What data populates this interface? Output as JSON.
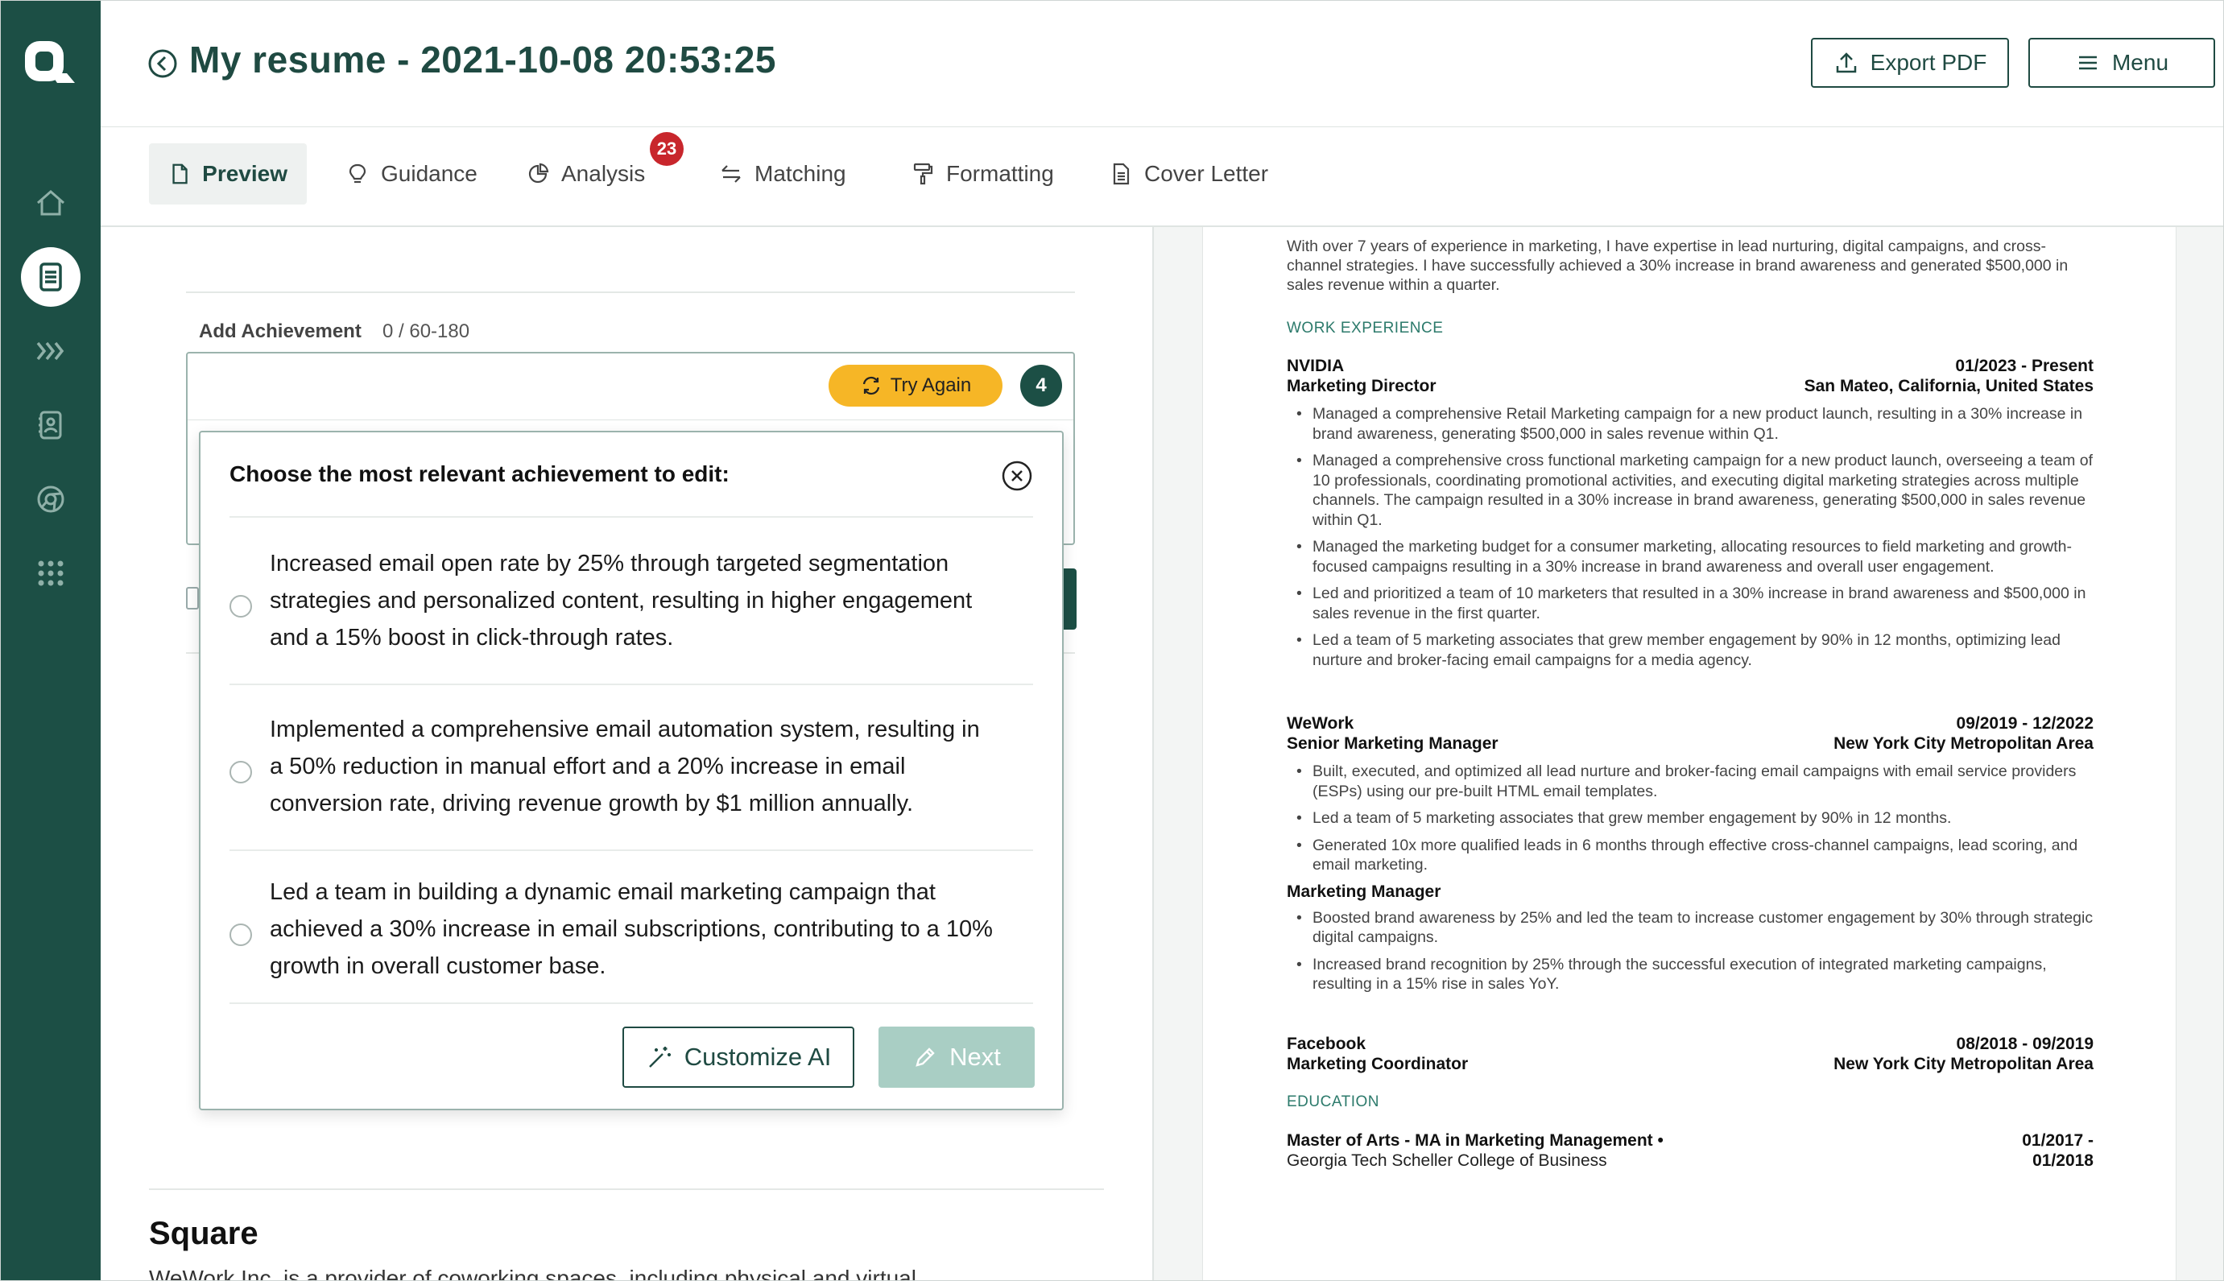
{
  "header": {
    "title": "My resume - 2021-10-08 20:53:25",
    "export_label": "Export PDF",
    "menu_label": "Menu"
  },
  "tabs": [
    {
      "label": "Preview",
      "icon": "document-icon",
      "active": true
    },
    {
      "label": "Guidance",
      "icon": "lightbulb-icon"
    },
    {
      "label": "Analysis",
      "icon": "pie-chart-icon",
      "badge": "23"
    },
    {
      "label": "Matching",
      "icon": "arrows-swap-icon"
    },
    {
      "label": "Formatting",
      "icon": "paint-roller-icon"
    },
    {
      "label": "Cover Letter",
      "icon": "file-text-icon"
    }
  ],
  "sidebar": {
    "items": [
      "home-icon",
      "resume-icon",
      "chevrons-icon",
      "contacts-icon",
      "chrome-icon",
      "apps-grid-icon"
    ],
    "active_index": 1
  },
  "editor": {
    "achievement_label": "Add Achievement",
    "achievement_count": "0 / 60-180",
    "try_again_label": "Try Again",
    "attempts": "4",
    "section_title": "Square",
    "section_cut_text": "WeWork Inc. is a provider of coworking spaces, including physical and virtual"
  },
  "modal": {
    "title": "Choose the most relevant achievement to edit:",
    "options": [
      {
        "lines": [
          "Increased email open rate by 25% through targeted segmentation",
          "strategies and personalized content, resulting in higher engagement",
          "and a 15% boost in click-through rates."
        ]
      },
      {
        "lines": [
          "Implemented a comprehensive email automation system, resulting in",
          "a 50% reduction in manual effort and a 20% increase in email",
          "conversion rate, driving revenue growth by $1 million annually."
        ]
      },
      {
        "lines": [
          "Led a team in building a dynamic email marketing campaign that",
          "achieved a 30% increase in email subscriptions, contributing to a 10%",
          "growth in overall customer base."
        ]
      }
    ],
    "customize_label": "Customize AI",
    "next_label": "Next"
  },
  "resume": {
    "summary": "With over 7 years of experience in marketing, I have expertise in lead nurturing, digital campaigns, and cross-channel strategies. I have successfully achieved a 30% increase in brand awareness and generated $500,000 in sales revenue within a quarter.",
    "work_heading": "WORK EXPERIENCE",
    "jobs": [
      {
        "company": "NVIDIA",
        "dates": "01/2023 - Present",
        "title": "Marketing Director",
        "location": "San Mateo, California, United States",
        "bullets": [
          "Managed a comprehensive Retail Marketing campaign for a new product launch, resulting in a 30% increase in brand awareness, generating $500,000 in sales revenue within Q1.",
          "Managed a comprehensive cross functional marketing campaign for a new product launch, overseeing a team of 10 professionals, coordinating promotional activities, and executing digital marketing strategies across multiple channels. The campaign resulted in a 30% increase in brand awareness, generating $500,000 in sales revenue within Q1.",
          "Managed the marketing budget for a consumer marketing, allocating resources to field marketing and growth-focused campaigns resulting in a 30% increase in brand awareness and overall user engagement.",
          "Led and prioritized a team of 10 marketers that resulted in a 30% increase in brand awareness and $500,000 in sales revenue in the first quarter.",
          "Led a team of 5 marketing associates that grew member engagement by 90% in 12 months, optimizing lead nurture and broker-facing email campaigns for a media agency."
        ]
      },
      {
        "company": "WeWork",
        "dates": "09/2019 - 12/2022",
        "title": "Senior Marketing Manager",
        "location": "New York City Metropolitan Area",
        "bullets": [
          "Built, executed, and optimized all lead nurture and broker-facing email campaigns with email service providers (ESPs) using our pre-built HTML email templates.",
          "Led a team of 5 marketing associates that grew member engagement by 90% in 12 months.",
          "Generated 10x more qualified leads in 6 months through effective cross-channel campaigns, lead scoring, and email marketing."
        ],
        "subrole": "Marketing Manager",
        "sub_bullets": [
          "Boosted brand awareness by 25% and led the team to increase customer engagement by 30% through strategic digital campaigns.",
          "Increased brand recognition by 25% through the successful execution of integrated marketing campaigns, resulting in a 15% rise in sales YoY."
        ]
      },
      {
        "company": "Facebook",
        "dates": "08/2018 - 09/2019",
        "title": "Marketing Coordinator",
        "location": "New York City Metropolitan Area"
      }
    ],
    "education_heading": "EDUCATION",
    "education": {
      "degree": "Master of Arts - MA in Marketing Management •",
      "school": "Georgia Tech Scheller College of Business",
      "dates_line1": "01/2017 -",
      "dates_line2": "01/2018"
    }
  }
}
